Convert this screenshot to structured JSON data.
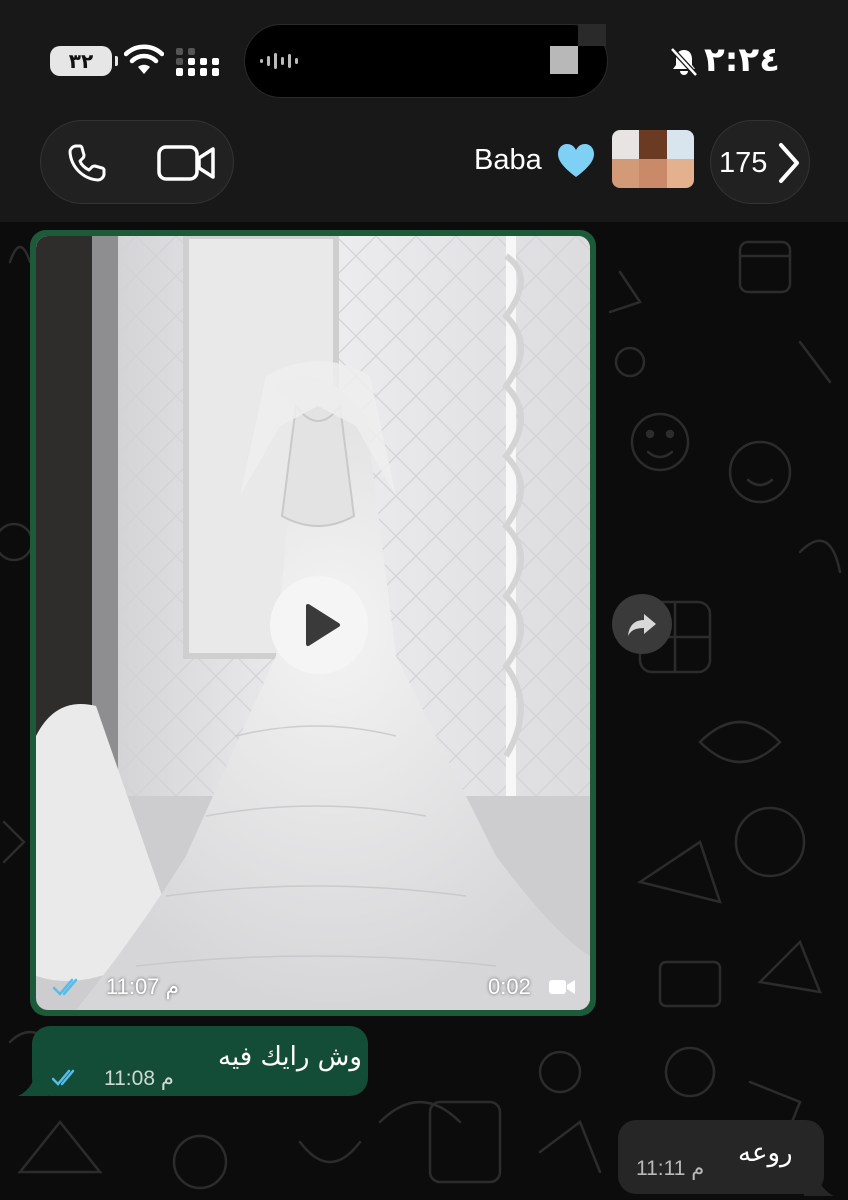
{
  "status_bar": {
    "battery_label": "٣٢",
    "time": "٢:٢٤"
  },
  "header": {
    "contact_name": "Baba",
    "unread_count": "175"
  },
  "messages": [
    {
      "type": "video",
      "direction": "outgoing",
      "time": "11:07 م",
      "duration": "0:02"
    },
    {
      "type": "text",
      "direction": "outgoing",
      "text": "وش رايك فيه",
      "time": "11:08 م"
    },
    {
      "type": "text",
      "direction": "incoming",
      "text": "روعه",
      "time": "11:11 م"
    }
  ],
  "colors": {
    "outgoing_bubble": "#144d37",
    "incoming_bubble": "#262626",
    "read_ticks": "#53bdeb",
    "heart": "#7fd0f5"
  },
  "icons": {
    "call": "phone-icon",
    "video_call": "video-camera-icon",
    "back": "chevron-right-icon",
    "forward": "forward-arrow-icon",
    "silent": "bell-slash-icon"
  }
}
